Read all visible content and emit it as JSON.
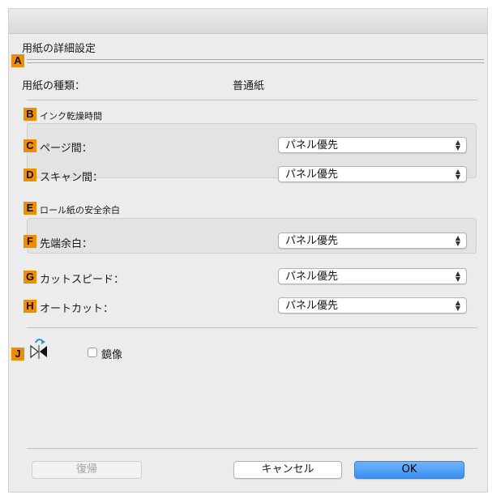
{
  "dialog": {
    "title": "用紙の詳細設定"
  },
  "badges": {
    "a": "A",
    "b": "B",
    "c": "C",
    "d": "D",
    "e": "E",
    "f": "F",
    "g": "G",
    "h": "H",
    "j": "J"
  },
  "media": {
    "label": "用紙の種類：",
    "value": "普通紙"
  },
  "ink_drying": {
    "heading": "インク乾燥時間",
    "between_pages_label": "ページ間：",
    "between_pages_value": "パネル優先",
    "between_scans_label": "スキャン間：",
    "between_scans_value": "パネル優先"
  },
  "roll_margin": {
    "heading": "ロール紙の安全余白",
    "leading_edge_label": "先端余白：",
    "leading_edge_value": "パネル優先"
  },
  "cut_speed": {
    "label": "カットスピード：",
    "value": "パネル優先"
  },
  "auto_cut": {
    "label": "オートカット：",
    "value": "パネル優先"
  },
  "mirror": {
    "label": "鏡像",
    "checked": false,
    "icon": "mirror-flip-icon"
  },
  "buttons": {
    "restore": "復帰",
    "cancel": "キャンセル",
    "ok": "OK"
  },
  "colors": {
    "badge": "#f08c00",
    "default_button": "#3a8ff2"
  }
}
